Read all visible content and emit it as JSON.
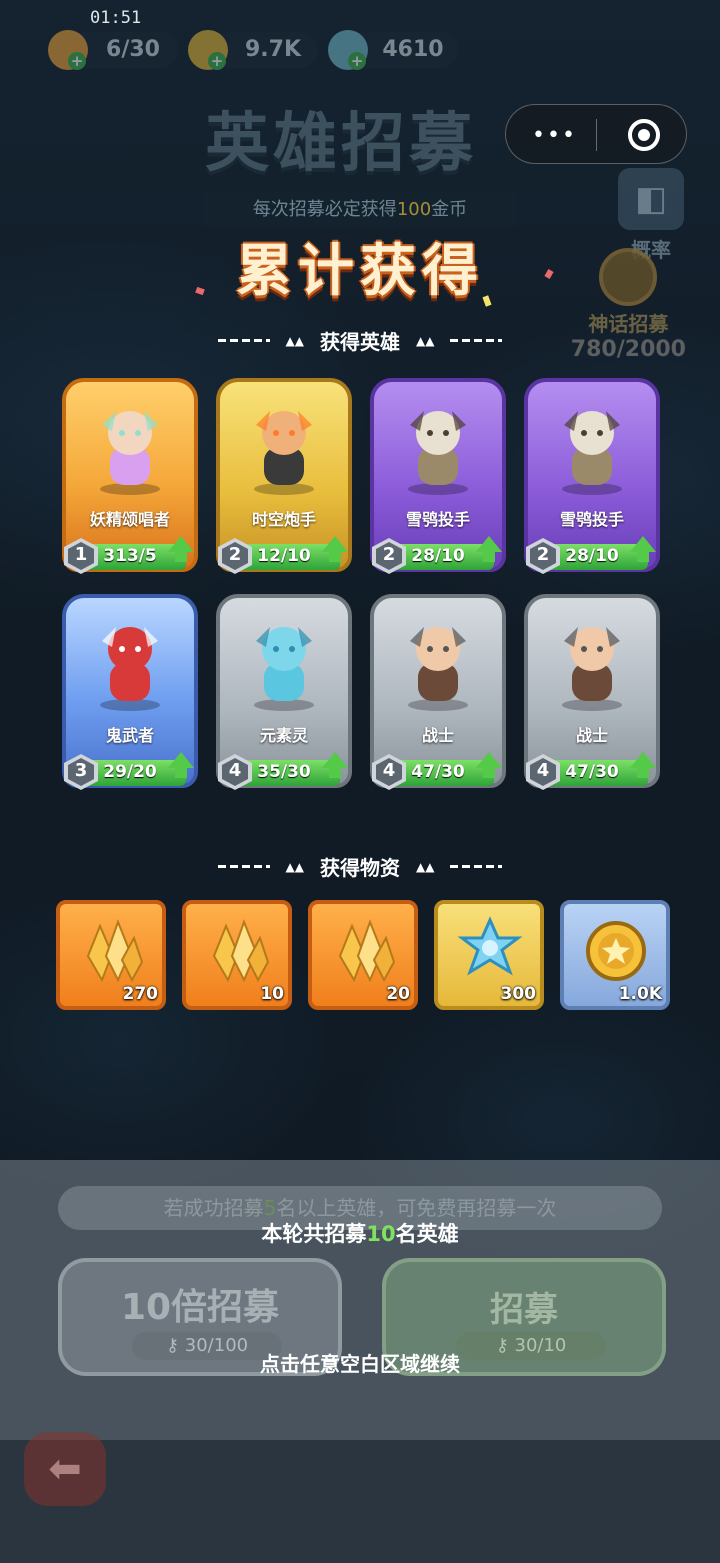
{
  "status_bar": {
    "time": "01:51"
  },
  "resources": [
    {
      "icon": "energy-flame-icon",
      "value": "6/30",
      "color": "#e8a13a"
    },
    {
      "icon": "gold-coin-icon",
      "value": "9.7K",
      "color": "#e0b43a"
    },
    {
      "icon": "crystal-flower-icon",
      "value": "4610",
      "color": "#6fb8c8"
    }
  ],
  "header": {
    "title": "英雄招募",
    "subtitle_prefix": "每次招募必定获得",
    "subtitle_highlight": "100",
    "subtitle_suffix": "金币"
  },
  "side": {
    "probability_label": "概率",
    "mythic_label": "神话招募",
    "mythic_progress": "780/2000"
  },
  "result": {
    "title": "累计获得",
    "heroes_section_label": "获得英雄",
    "items_section_label": "获得物资"
  },
  "heroes": [
    {
      "name": "妖精颂唱者",
      "level": "1",
      "progress": "313/5",
      "fill": 1.0,
      "rarity": "orange",
      "icon": "fairy-singer-icon"
    },
    {
      "name": "时空炮手",
      "level": "2",
      "progress": "12/10",
      "fill": 1.0,
      "rarity": "gold",
      "icon": "spacetime-gunner-icon"
    },
    {
      "name": "雪鸮投手",
      "level": "2",
      "progress": "28/10",
      "fill": 1.0,
      "rarity": "purple",
      "icon": "snow-owl-thrower-icon"
    },
    {
      "name": "雪鸮投手",
      "level": "2",
      "progress": "28/10",
      "fill": 1.0,
      "rarity": "purple",
      "icon": "snow-owl-thrower-icon"
    },
    {
      "name": "鬼武者",
      "level": "3",
      "progress": "29/20",
      "fill": 1.0,
      "rarity": "blue",
      "icon": "oni-warrior-icon"
    },
    {
      "name": "元素灵",
      "level": "4",
      "progress": "35/30",
      "fill": 1.0,
      "rarity": "gray",
      "icon": "elemental-spirit-icon"
    },
    {
      "name": "战士",
      "level": "4",
      "progress": "47/30",
      "fill": 1.0,
      "rarity": "gray",
      "icon": "warrior-icon"
    },
    {
      "name": "战士",
      "level": "4",
      "progress": "47/30",
      "fill": 1.0,
      "rarity": "gray",
      "icon": "warrior-icon"
    }
  ],
  "items": [
    {
      "icon": "gold-crystal-icon",
      "qty": "270",
      "frame": "orange"
    },
    {
      "icon": "gold-crystal-icon",
      "qty": "10",
      "frame": "orange"
    },
    {
      "icon": "gold-crystal-icon",
      "qty": "20",
      "frame": "orange"
    },
    {
      "icon": "ice-snowflake-icon",
      "qty": "300",
      "frame": "gold"
    },
    {
      "icon": "gold-coin-icon",
      "qty": "1.0K",
      "frame": "blue"
    }
  ],
  "bottom": {
    "bonus_hint_prefix": "若成功招募",
    "bonus_hint_highlight": "5",
    "bonus_hint_suffix": "名以上英雄，可免费再招募一次",
    "round_prefix": "本轮共招募",
    "round_highlight": "10",
    "round_suffix": "名英雄",
    "recruit_10x_num": "10",
    "recruit_10x_label": "倍招募",
    "recruit_10x_cost": "30/100",
    "recruit_1x_label": "招募",
    "recruit_1x_cost": "30/10",
    "continue_hint": "点击任意空白区域继续"
  },
  "colors": {
    "highlight_green": "#7ee260",
    "title_outline": "#c8621e"
  }
}
